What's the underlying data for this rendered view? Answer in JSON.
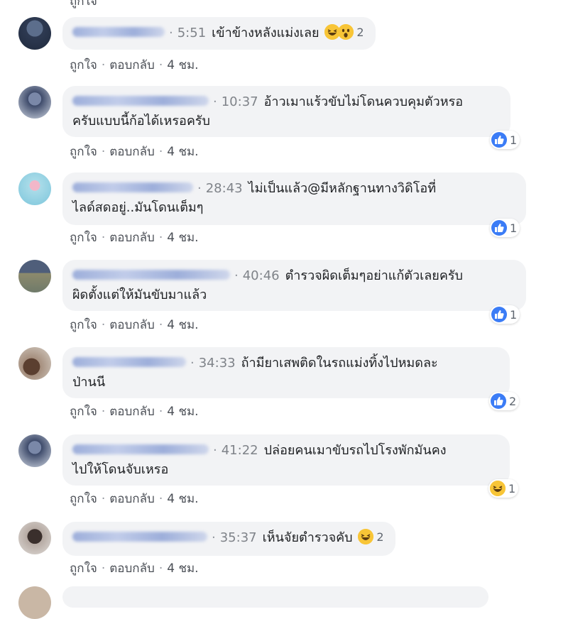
{
  "labels": {
    "like": "ถูกใจ",
    "reply": "ตอบกลับ"
  },
  "sep": "·",
  "comments": [
    {
      "timestamp": "5:51",
      "text_line1": "เข้าข้างหลังแม่งเลย",
      "text_line2": "",
      "time_ago": "4 ชม.",
      "reaction": {
        "type": "haha+wow",
        "count": "2"
      },
      "avatar_color": "#3a4a63"
    },
    {
      "timestamp": "10:37",
      "text_line1": "อ้าวเมาแร้วขับไม่โดนควบคุมตัวหรอ",
      "text_line2": "ครับแบบนี้ก้อได้เหรอครับ",
      "time_ago": "4 ชม.",
      "reaction": {
        "type": "like",
        "count": "1"
      },
      "avatar_color": "#4c5a78"
    },
    {
      "timestamp": "28:43",
      "text_line1": "ไม่เป็นแล้ว@มีหลักฐานทางวิดิโอที่",
      "text_line2": "ไลด์สดอยู่..มันโดนเต็มๆ",
      "time_ago": "4 ชม.",
      "reaction": {
        "type": "like",
        "count": "1"
      },
      "avatar_color": "#8fcfe0"
    },
    {
      "timestamp": "40:46",
      "text_line1": "ตำรวจผิดเต็มๆอย่าแก้ตัวเลยครับ",
      "text_line2": "ผิดตั้งแต่ให้มันขับมาแล้ว",
      "time_ago": "4 ชม.",
      "reaction": {
        "type": "like",
        "count": "1"
      },
      "avatar_color": "#6f7a6a"
    },
    {
      "timestamp": "34:33",
      "text_line1": "ถ้ามียาเสพติดในรถแม่งทิ้งไปหมดละ",
      "text_line2": "ป่านนี",
      "time_ago": "4 ชม.",
      "reaction": {
        "type": "like",
        "count": "2"
      },
      "avatar_color": "#7a6455"
    },
    {
      "timestamp": "41:22",
      "text_line1": "ปล่อยคนเมาขับรถไปโรงพักมันคง",
      "text_line2": "ไปให้โดนจับเหรอ",
      "time_ago": "4 ชม.",
      "reaction": {
        "type": "haha",
        "count": "1"
      },
      "avatar_color": "#4c5a78"
    },
    {
      "timestamp": "35:37",
      "text_line1": "เห็นจัยตำรวจคับ",
      "text_line2": "",
      "time_ago": "4 ชม.",
      "reaction": {
        "type": "haha",
        "count": "2"
      },
      "avatar_color": "#5b4f4a"
    }
  ],
  "colors": {
    "like_blue": "#3b7cf6",
    "haha_yellow": "#f8c537",
    "bubble_bg": "#f2f3f5",
    "meta_gray": "#7f8389"
  },
  "icons": {
    "like": "like-reaction-icon",
    "haha": "haha-reaction-icon",
    "wow": "wow-reaction-icon"
  }
}
